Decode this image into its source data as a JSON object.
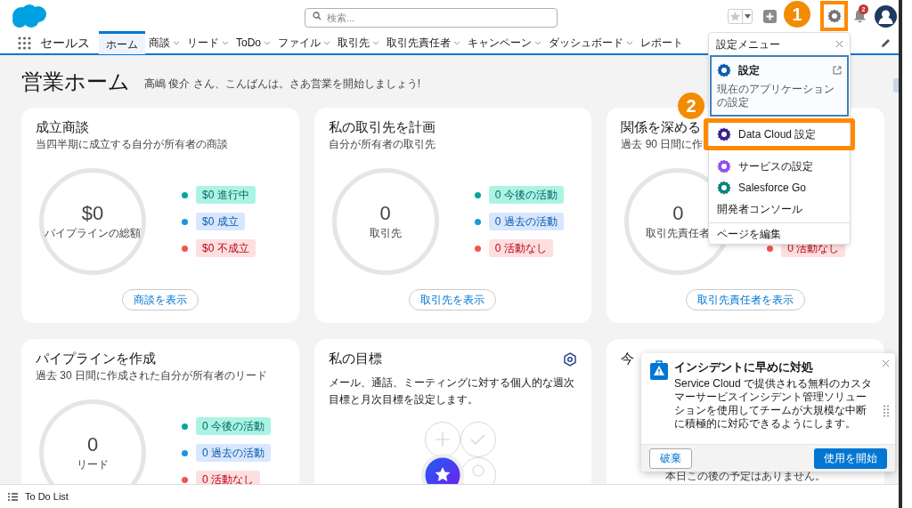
{
  "header": {
    "search": {
      "placeholder": "検索..."
    },
    "notifications": {
      "count": "2"
    }
  },
  "nav": {
    "app_name": "セールス",
    "tabs": [
      {
        "label": "ホーム",
        "selected": true,
        "dropdown": false
      },
      {
        "label": "商談",
        "selected": false,
        "dropdown": true
      },
      {
        "label": "リード",
        "selected": false,
        "dropdown": true
      },
      {
        "label": "ToDo",
        "selected": false,
        "dropdown": true
      },
      {
        "label": "ファイル",
        "selected": false,
        "dropdown": true
      },
      {
        "label": "取引先",
        "selected": false,
        "dropdown": true
      },
      {
        "label": "取引先責任者",
        "selected": false,
        "dropdown": true
      },
      {
        "label": "キャンペーン",
        "selected": false,
        "dropdown": true
      },
      {
        "label": "ダッシュボード",
        "selected": false,
        "dropdown": true
      },
      {
        "label": "レポート",
        "selected": false,
        "dropdown": false
      }
    ]
  },
  "page": {
    "title": "営業ホーム",
    "greeting": "高嶋 俊介 さん、こんばんは。さあ営業を開始しましょう!"
  },
  "cards": [
    {
      "kind": "metric",
      "title": "成立商談",
      "subtitle": "当四半期に成立する自分が所有者の商談",
      "total": {
        "value": "$0",
        "label": "パイプラインの総額"
      },
      "legend": [
        {
          "label": "$0 進行中",
          "kind": "green",
          "color": "#06a59a"
        },
        {
          "label": "$0 成立",
          "kind": "blue",
          "color": "#1b96dd"
        },
        {
          "label": "$0 不成立",
          "kind": "red",
          "color": "#f0574a"
        }
      ],
      "button": "商談を表示"
    },
    {
      "kind": "metric",
      "title": "私の取引先を計画",
      "subtitle": "自分が所有者の取引先",
      "total": {
        "value": "0",
        "label": "取引先"
      },
      "legend": [
        {
          "label": "0 今後の活動",
          "kind": "green",
          "color": "#06a59a"
        },
        {
          "label": "0 過去の活動",
          "kind": "blue",
          "color": "#1b96dd"
        },
        {
          "label": "0 活動なし",
          "kind": "red",
          "color": "#f0574a"
        }
      ],
      "button": "取引先を表示"
    },
    {
      "kind": "metric",
      "title": "関係を深める",
      "subtitle": "過去 90 日間に作",
      "total": {
        "value": "0",
        "label": "取引先責任者"
      },
      "legend": [
        {
          "label": "0 活動なし",
          "kind": "red",
          "color": "#f0574a"
        }
      ],
      "button": "取引先責任者を表示"
    },
    {
      "kind": "metric",
      "title": "パイプラインを作成",
      "subtitle": "過去 30 日間に作成された自分が所有者のリード",
      "total": {
        "value": "0",
        "label": "リード"
      },
      "legend": [
        {
          "label": "0 今後の活動",
          "kind": "green",
          "color": "#06a59a"
        },
        {
          "label": "0 過去の活動",
          "kind": "blue",
          "color": "#1b96dd"
        },
        {
          "label": "0 活動なし",
          "kind": "red",
          "color": "#f0574a"
        }
      ]
    },
    {
      "kind": "goals",
      "title": "私の目標",
      "description": "メール、通話、ミーティングに対する個人的な週次目標と月次目標を設定します。"
    },
    {
      "kind": "today",
      "title": "今",
      "message": "本日この後の予定はありません。"
    }
  ],
  "settings_menu": {
    "title": "設定メニュー",
    "items": [
      {
        "label": "設定",
        "subtitle": "現在のアプリケーションの設定",
        "kind": "app",
        "color": "#0b5cab",
        "selected": true,
        "external": true
      },
      {
        "label": "Data Cloud 設定",
        "kind": "app",
        "color": "#3a1f8f",
        "selected": false,
        "external": false
      },
      {
        "label": "サービスの設定",
        "kind": "app",
        "color": "#9050e9",
        "selected": false,
        "external": false
      },
      {
        "label": "Salesforce Go",
        "kind": "app",
        "color": "#0b827c",
        "selected": false,
        "external": false
      },
      {
        "label": "開発者コンソール",
        "kind": "link",
        "selected": false,
        "external": false
      }
    ],
    "footer_items": [
      {
        "label": "ページを編集"
      }
    ]
  },
  "step_markers": [
    {
      "label": "1"
    },
    {
      "label": "2"
    }
  ],
  "incident_popup": {
    "title": "インシデントに早めに対処",
    "body": "Service Cloud で提供される無料のカスタマーサービスインシデント管理ソリューションを使用してチームが大規模な中断に積極的に対応できるようにします。",
    "buttons": [
      {
        "label": "破棄",
        "kind": "neutral"
      },
      {
        "label": "使用を開始",
        "kind": "brand"
      }
    ]
  },
  "utility_bar": {
    "label": "To Do List"
  }
}
